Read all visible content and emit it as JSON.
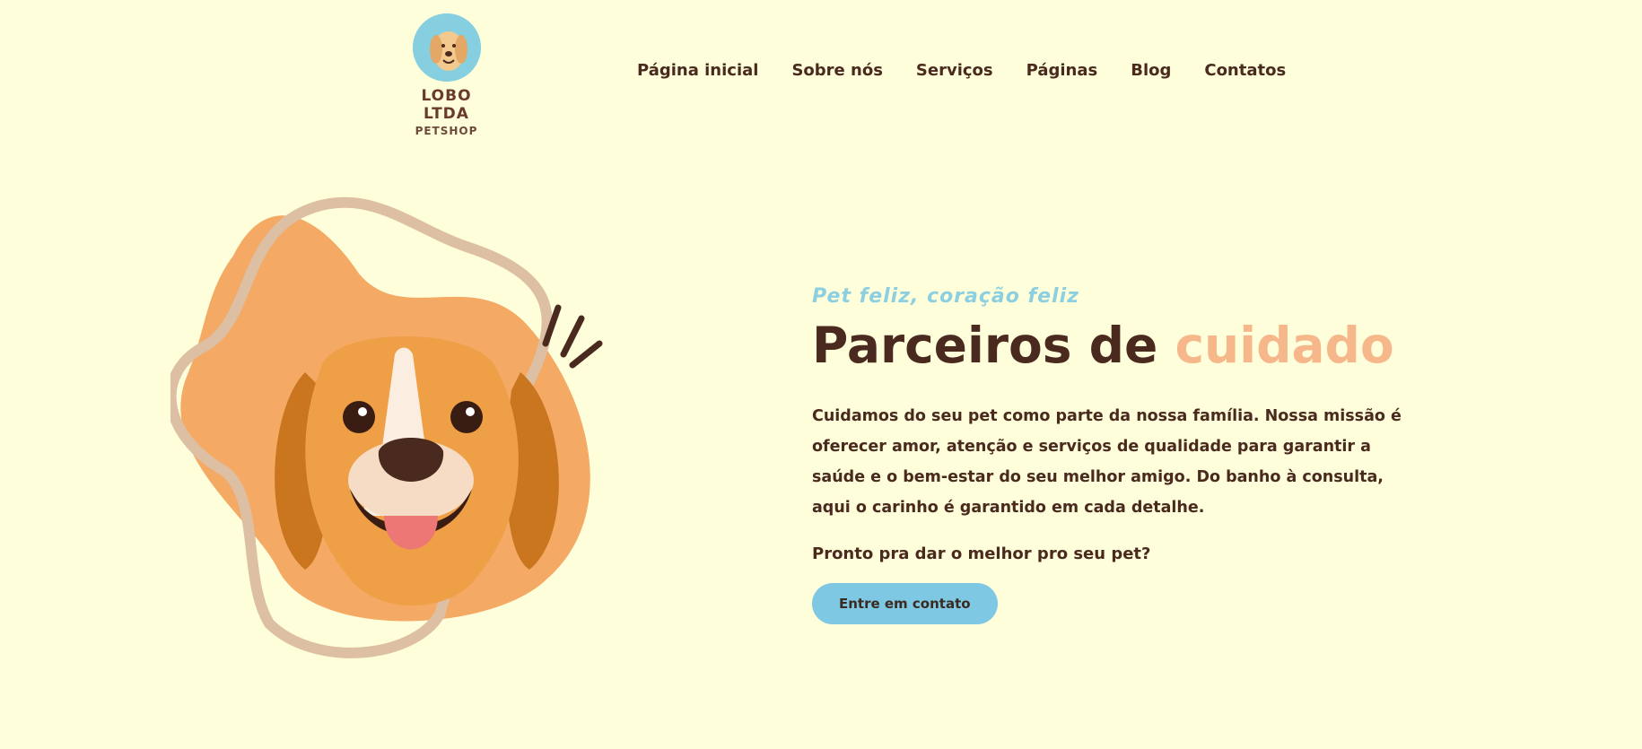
{
  "brand": {
    "name": "LOBO LTDA",
    "sub": "PETSHOP"
  },
  "nav": [
    {
      "label": "Página inicial"
    },
    {
      "label": "Sobre nós"
    },
    {
      "label": "Serviços"
    },
    {
      "label": "Páginas"
    },
    {
      "label": "Blog"
    },
    {
      "label": "Contatos"
    }
  ],
  "hero": {
    "tagline": "Pet feliz, coração feliz",
    "title_main": "Parceiros de ",
    "title_accent": "cuidado",
    "description": "Cuidamos do seu pet como parte da nossa família. Nossa missão é oferecer amor, atenção e serviços de qualidade para garantir a saúde e o bem-estar do seu melhor amigo. Do banho à consulta, aqui o carinho é garantido em cada detalhe.",
    "cta_question": "Pronto pra dar o melhor pro seu pet?",
    "cta_button": "Entre em contato"
  },
  "colors": {
    "background": "#fefedb",
    "text": "#4a2a1e",
    "accent_orange": "#f6b88a",
    "accent_blue": "#7ec8e3"
  },
  "icons": {
    "logo": "dog-logo-icon",
    "hero": "beagle-illustration"
  }
}
